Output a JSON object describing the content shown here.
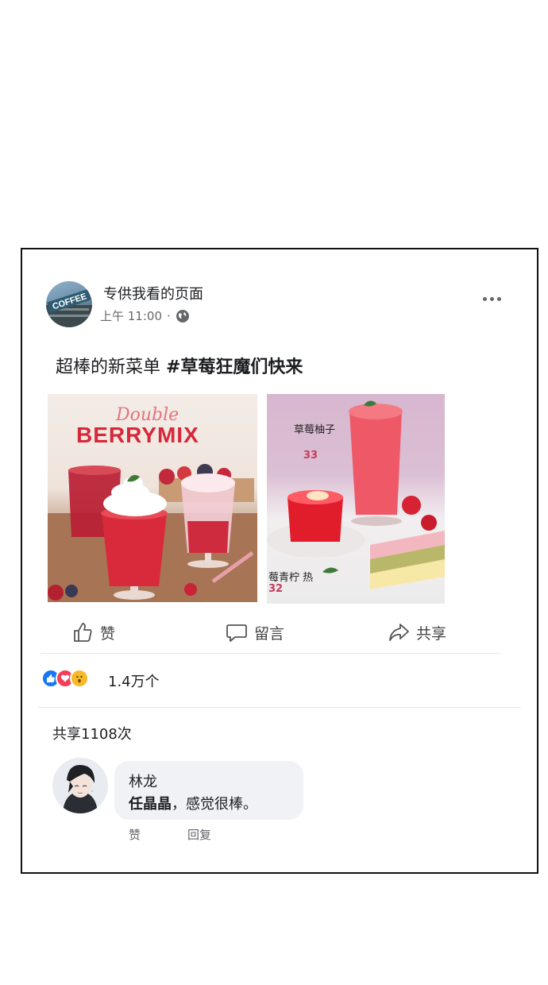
{
  "post": {
    "page_name": "专供我看的页面",
    "time": "上午 11:00",
    "separator": "·",
    "avatar_text": "COFFEE",
    "caption_plain": "超棒的新菜单 ",
    "caption_tag": "#草莓狂魔们快来"
  },
  "photos": {
    "left": {
      "script": "Double",
      "title": "BERRYMIX"
    },
    "right": {
      "item1_name": "草莓柚子",
      "item1_price": "33",
      "item2_name": "莓青柠 热",
      "item2_price": "32"
    }
  },
  "actions": {
    "like": "赞",
    "comment": "留言",
    "share": "共享"
  },
  "reactions": {
    "icons": [
      "like-icon",
      "love-icon",
      "wow-icon"
    ],
    "count": "1.4万个"
  },
  "shares_text": "共享1108次",
  "comment": {
    "author": "林龙",
    "mention": "任晶晶",
    "text": "，感觉很棒。",
    "like": "赞",
    "reply": "回复"
  },
  "colors": {
    "like_blue": "#1877f2",
    "love_red": "#f33e58",
    "wow_yellow": "#f7b928"
  }
}
